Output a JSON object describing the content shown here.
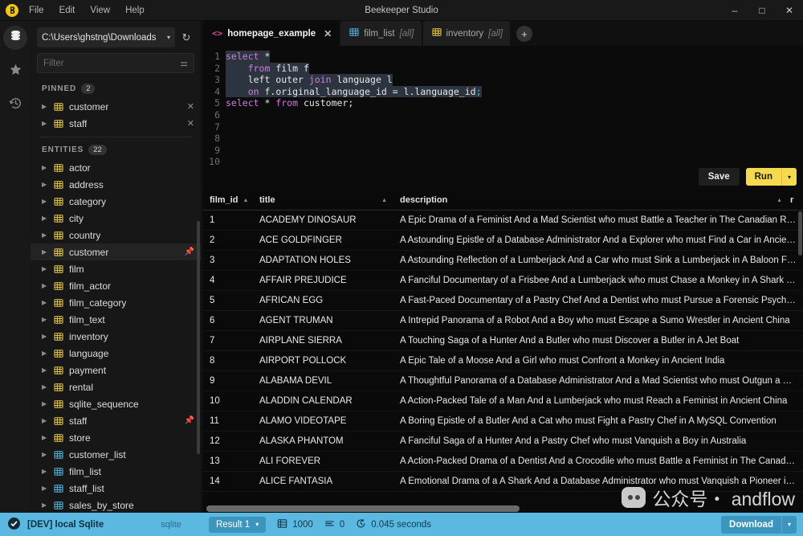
{
  "window": {
    "title": "Beekeeper Studio",
    "menu": [
      "File",
      "Edit",
      "View",
      "Help"
    ],
    "controls": {
      "minimize": "–",
      "maximize": "□",
      "close": "✕"
    },
    "logo_icon": "beekeeper-logo-icon"
  },
  "rail": {
    "items": [
      {
        "icon": "database-icon",
        "name": "database",
        "active": true
      },
      {
        "icon": "star-icon",
        "name": "favorites",
        "active": false
      },
      {
        "icon": "history-icon",
        "name": "history",
        "active": false
      }
    ]
  },
  "sidebar": {
    "connection": {
      "value": "C:\\Users\\ghstng\\Downloads",
      "caret": "▾",
      "refresh_icon": "refresh-icon"
    },
    "filter": {
      "placeholder": "Filter",
      "value": "",
      "icon": "filter-icon"
    },
    "pinned": {
      "label": "PINNED",
      "count": "2",
      "items": [
        {
          "label": "customer",
          "kind": "table",
          "action": "✕"
        },
        {
          "label": "staff",
          "kind": "table",
          "action": "✕"
        }
      ]
    },
    "entities": {
      "label": "ENTITIES",
      "count": "22",
      "items": [
        {
          "label": "actor",
          "kind": "table",
          "pinned": false,
          "selected": false
        },
        {
          "label": "address",
          "kind": "table",
          "pinned": false,
          "selected": false
        },
        {
          "label": "category",
          "kind": "table",
          "pinned": false,
          "selected": false
        },
        {
          "label": "city",
          "kind": "table",
          "pinned": false,
          "selected": false
        },
        {
          "label": "country",
          "kind": "table",
          "pinned": false,
          "selected": false
        },
        {
          "label": "customer",
          "kind": "table",
          "pinned": true,
          "selected": true
        },
        {
          "label": "film",
          "kind": "table",
          "pinned": false,
          "selected": false
        },
        {
          "label": "film_actor",
          "kind": "table",
          "pinned": false,
          "selected": false
        },
        {
          "label": "film_category",
          "kind": "table",
          "pinned": false,
          "selected": false
        },
        {
          "label": "film_text",
          "kind": "table",
          "pinned": false,
          "selected": false
        },
        {
          "label": "inventory",
          "kind": "table",
          "pinned": false,
          "selected": false
        },
        {
          "label": "language",
          "kind": "table",
          "pinned": false,
          "selected": false
        },
        {
          "label": "payment",
          "kind": "table",
          "pinned": false,
          "selected": false
        },
        {
          "label": "rental",
          "kind": "table",
          "pinned": false,
          "selected": false
        },
        {
          "label": "sqlite_sequence",
          "kind": "table",
          "pinned": false,
          "selected": false
        },
        {
          "label": "staff",
          "kind": "table",
          "pinned": true,
          "selected": false
        },
        {
          "label": "store",
          "kind": "table",
          "pinned": false,
          "selected": false
        },
        {
          "label": "customer_list",
          "kind": "view",
          "pinned": false,
          "selected": false
        },
        {
          "label": "film_list",
          "kind": "view",
          "pinned": false,
          "selected": false
        },
        {
          "label": "staff_list",
          "kind": "view",
          "pinned": false,
          "selected": false
        },
        {
          "label": "sales_by_store",
          "kind": "view",
          "pinned": false,
          "selected": false
        }
      ]
    }
  },
  "tabs": {
    "items": [
      {
        "label": "homepage_example",
        "sub": "",
        "kind": "query",
        "active": true,
        "close": "✕"
      },
      {
        "label": "film_list",
        "sub": "[all]",
        "kind": "view",
        "active": false
      },
      {
        "label": "inventory",
        "sub": "[all]",
        "kind": "table",
        "active": false
      }
    ],
    "add_label": "+"
  },
  "editor": {
    "lines": [
      {
        "n": "1",
        "highlighted": true,
        "tokens": [
          {
            "t": "select",
            "c": "kw"
          },
          {
            "t": " *",
            "c": "plain"
          }
        ]
      },
      {
        "n": "2",
        "highlighted": true,
        "tokens": [
          {
            "t": "    ",
            "c": "plain"
          },
          {
            "t": "from",
            "c": "kw"
          },
          {
            "t": " film f",
            "c": "plain"
          }
        ]
      },
      {
        "n": "3",
        "highlighted": true,
        "tokens": [
          {
            "t": "    left outer ",
            "c": "plain"
          },
          {
            "t": "join",
            "c": "kw"
          },
          {
            "t": " language l",
            "c": "plain"
          }
        ]
      },
      {
        "n": "4",
        "highlighted": true,
        "tokens": [
          {
            "t": "    ",
            "c": "plain"
          },
          {
            "t": "on",
            "c": "kw"
          },
          {
            "t": " f.original_language_id = l.language_id",
            "c": "plain"
          },
          {
            "t": ";",
            "c": "pn"
          }
        ]
      },
      {
        "n": "5",
        "highlighted": false,
        "tokens": [
          {
            "t": "select",
            "c": "kw"
          },
          {
            "t": " * ",
            "c": "plain"
          },
          {
            "t": "from",
            "c": "kw"
          },
          {
            "t": " customer;",
            "c": "plain"
          }
        ]
      },
      {
        "n": "6",
        "highlighted": false,
        "tokens": []
      },
      {
        "n": "7",
        "highlighted": false,
        "tokens": []
      },
      {
        "n": "8",
        "highlighted": false,
        "tokens": []
      },
      {
        "n": "9",
        "highlighted": false,
        "tokens": []
      },
      {
        "n": "10",
        "highlighted": false,
        "tokens": []
      }
    ],
    "save_label": "Save",
    "run_label": "Run",
    "run_caret": "▾"
  },
  "results": {
    "columns": [
      {
        "label": "film_id",
        "sort": "▲"
      },
      {
        "label": "title",
        "sort": "▲"
      },
      {
        "label": "description",
        "sort": ""
      },
      {
        "label": "r",
        "sort": ""
      }
    ],
    "rows": [
      {
        "film_id": "1",
        "title": "ACADEMY DINOSAUR",
        "description": "A Epic Drama of a Feminist And a Mad Scientist who must Battle a Teacher in The Canadian Rockies"
      },
      {
        "film_id": "2",
        "title": "ACE GOLDFINGER",
        "description": "A Astounding Epistle of a Database Administrator And a Explorer who must Find a Car in Ancient China"
      },
      {
        "film_id": "3",
        "title": "ADAPTATION HOLES",
        "description": "A Astounding Reflection of a Lumberjack And a Car who must Sink a Lumberjack in A Baloon Factory"
      },
      {
        "film_id": "4",
        "title": "AFFAIR PREJUDICE",
        "description": "A Fanciful Documentary of a Frisbee And a Lumberjack who must Chase a Monkey in A Shark Tank"
      },
      {
        "film_id": "5",
        "title": "AFRICAN EGG",
        "description": "A Fast-Paced Documentary of a Pastry Chef And a Dentist who must Pursue a Forensic Psychologist in The Gulf of Mexico"
      },
      {
        "film_id": "6",
        "title": "AGENT TRUMAN",
        "description": "A Intrepid Panorama of a Robot And a Boy who must Escape a Sumo Wrestler in Ancient China"
      },
      {
        "film_id": "7",
        "title": "AIRPLANE SIERRA",
        "description": "A Touching Saga of a Hunter And a Butler who must Discover a Butler in A Jet Boat"
      },
      {
        "film_id": "8",
        "title": "AIRPORT POLLOCK",
        "description": "A Epic Tale of a Moose And a Girl who must Confront a Monkey in Ancient India"
      },
      {
        "film_id": "9",
        "title": "ALABAMA DEVIL",
        "description": "A Thoughtful Panorama of a Database Administrator And a Mad Scientist who must Outgun a Mad Scientist in A Jet Boat"
      },
      {
        "film_id": "10",
        "title": "ALADDIN CALENDAR",
        "description": "A Action-Packed Tale of a Man And a Lumberjack who must Reach a Feminist in Ancient China"
      },
      {
        "film_id": "11",
        "title": "ALAMO VIDEOTAPE",
        "description": "A Boring Epistle of a Butler And a Cat who must Fight a Pastry Chef in A MySQL Convention"
      },
      {
        "film_id": "12",
        "title": "ALASKA PHANTOM",
        "description": "A Fanciful Saga of a Hunter And a Pastry Chef who must Vanquish a Boy in Australia"
      },
      {
        "film_id": "13",
        "title": "ALI FOREVER",
        "description": "A Action-Packed Drama of a Dentist And a Crocodile who must Battle a Feminist in The Canadian Rockies"
      },
      {
        "film_id": "14",
        "title": "ALICE FANTASIA",
        "description": "A Emotional Drama of a A Shark And a Database Administrator who must Vanquish a Pioneer in Soviet Georgia"
      }
    ]
  },
  "status": {
    "connection_name": "[DEV] local Sqlite",
    "connection_type": "sqlite",
    "result_label": "Result 1",
    "result_caret": "▾",
    "row_count": "1000",
    "affected_count": "0",
    "duration": "0.045 seconds",
    "download_label": "Download",
    "download_caret": "▾",
    "check_icon": "check-circle-icon",
    "rows_icon": "table-rows-icon",
    "affected_icon": "lines-icon",
    "timer_icon": "timer-icon"
  },
  "watermark": {
    "text": "公众号・ andflow"
  },
  "colors": {
    "accent_yellow": "#f5d94e",
    "status_blue": "#5bb8e0",
    "view_icon": "#4fb3e0",
    "table_icon": "#e8c84a",
    "keyword": "#cf7de0"
  }
}
